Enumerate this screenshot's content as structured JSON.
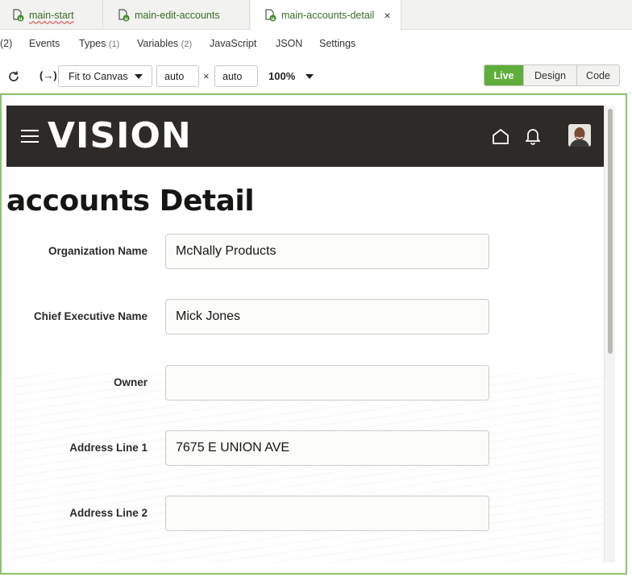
{
  "tabs": [
    {
      "label": "main-start"
    },
    {
      "label": "main-edit-accounts"
    },
    {
      "label": "main-accounts-detail",
      "active": true,
      "close": "×"
    }
  ],
  "subnav": {
    "leading_count": "(2)",
    "items": [
      {
        "label": "Events",
        "count": ""
      },
      {
        "label": "Types",
        "count": "(1)"
      },
      {
        "label": "Variables",
        "count": "(2)"
      },
      {
        "label": "JavaScript",
        "count": ""
      },
      {
        "label": "JSON",
        "count": ""
      },
      {
        "label": "Settings",
        "count": ""
      }
    ]
  },
  "toolbar": {
    "refresh_icon": "refresh-icon",
    "expression_icon": "(→)",
    "fit_label": "Fit to Canvas",
    "width_value": "auto",
    "times": "×",
    "height_value": "auto",
    "zoom": "100%",
    "modes": [
      {
        "label": "Live",
        "active": true
      },
      {
        "label": "Design",
        "active": false
      },
      {
        "label": "Code",
        "active": false
      }
    ]
  },
  "app": {
    "logo": "VISION",
    "page_title": "accounts Detail",
    "fields": [
      {
        "label": "Organization Name",
        "value": "McNally Products"
      },
      {
        "label": "Chief Executive Name",
        "value": "Mick Jones"
      },
      {
        "label": "Owner",
        "value": ""
      },
      {
        "label": "Address Line 1",
        "value": "7675 E UNION AVE"
      },
      {
        "label": "Address Line 2",
        "value": ""
      }
    ]
  },
  "colors": {
    "accent_green": "#5fae3c",
    "header_dark": "#2e2a27",
    "tab_text": "#3a6b2a"
  }
}
